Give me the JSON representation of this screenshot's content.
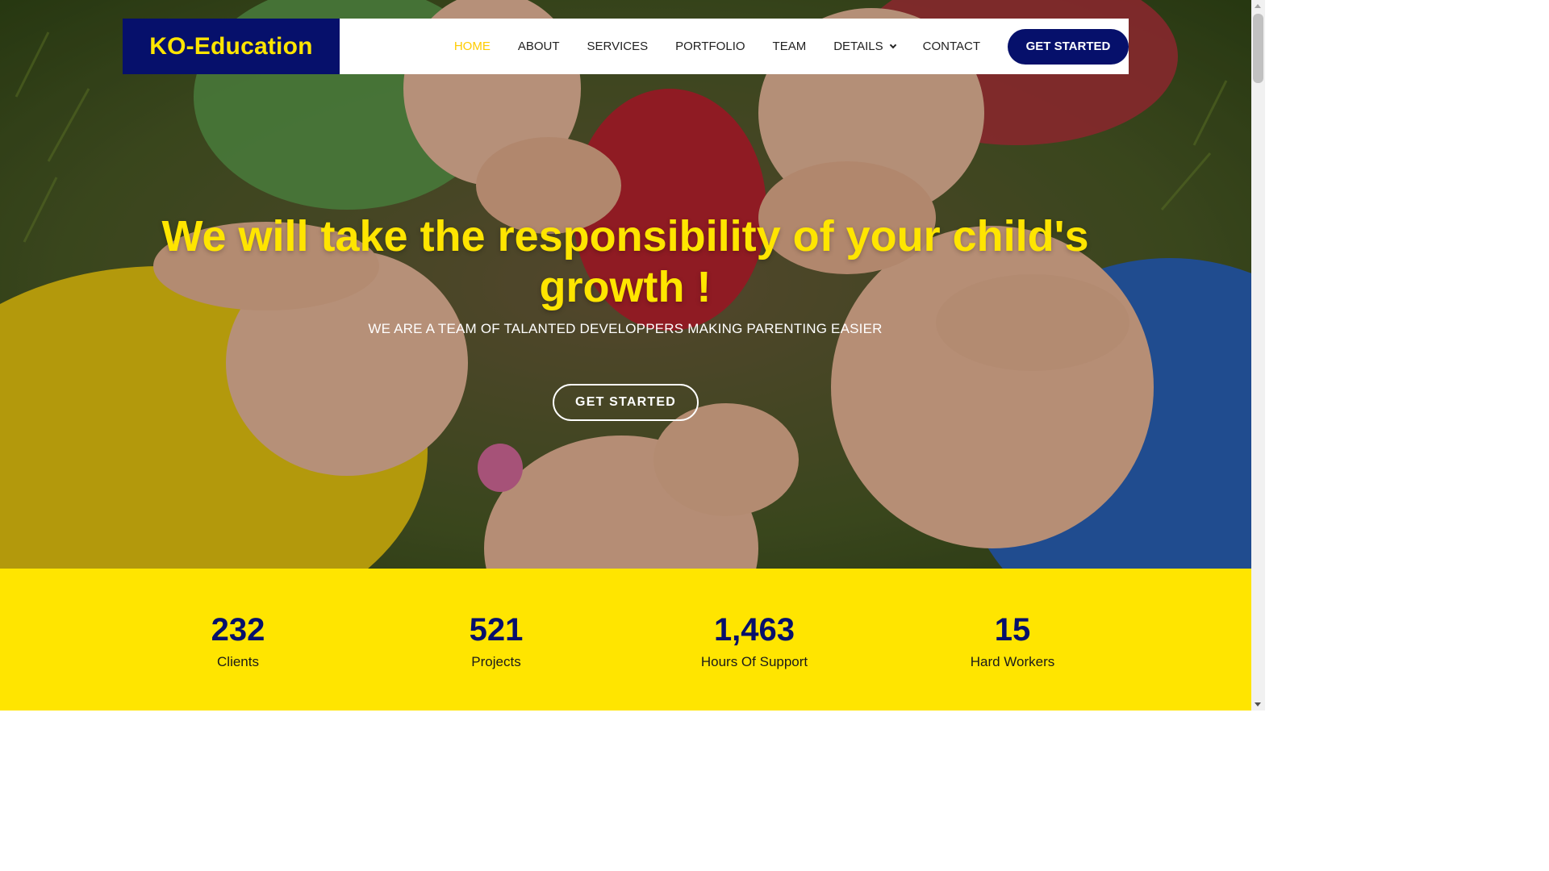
{
  "header": {
    "logo": "KO-Education",
    "nav": [
      {
        "label": "HOME"
      },
      {
        "label": "ABOUT"
      },
      {
        "label": "SERVICES"
      },
      {
        "label": "PORTFOLIO"
      },
      {
        "label": "TEAM"
      },
      {
        "label": "DETAILS"
      },
      {
        "label": "CONTACT"
      }
    ],
    "cta": "GET STARTED"
  },
  "hero": {
    "title": "We will take the responsibility of your child's growth !",
    "subtitle": "WE ARE A TEAM OF TALANTED DEVELOPPERS MAKING PARENTING EASIER",
    "cta": "GET STARTED"
  },
  "stats": [
    {
      "value": "232",
      "label": "Clients"
    },
    {
      "value": "521",
      "label": "Projects"
    },
    {
      "value": "1,463",
      "label": "Hours Of Support"
    },
    {
      "value": "15",
      "label": "Hard Workers"
    }
  ],
  "colors": {
    "brand_navy": "#06106b",
    "brand_yellow": "#ffe500",
    "nav_active": "#ffcc00"
  },
  "icons": {
    "details_dropdown": "chevron-down-icon"
  }
}
